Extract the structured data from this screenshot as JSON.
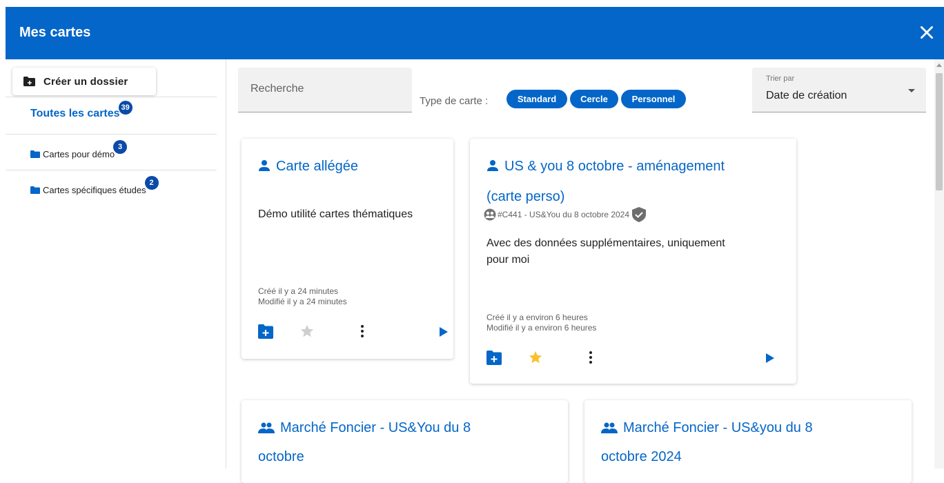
{
  "header": {
    "title": "Mes cartes",
    "close_icon": "close-icon"
  },
  "sidebar": {
    "create_button_label": "Créer un dossier",
    "all_cards": {
      "label": "Toutes les cartes",
      "count": "39"
    },
    "folders": [
      {
        "label": "Cartes pour démo",
        "count": "3"
      },
      {
        "label": "Cartes spécifiques études",
        "count": "2"
      }
    ]
  },
  "filters": {
    "search_placeholder": "Recherche",
    "type_label": "Type de carte :",
    "chips": [
      "Standard",
      "Cercle",
      "Personnel"
    ],
    "sort_caption": "Trier par",
    "sort_value": "Date de création"
  },
  "cards": [
    {
      "title": "Carte allégée",
      "icon": "person-icon",
      "description": "Démo utilité cartes thématiques",
      "created": "Créé il y a 24 minutes",
      "modified": "Modifié il y a 24 minutes",
      "starred": false
    },
    {
      "title_line1": "US & you 8 octobre - aménagement",
      "title_line2": "(carte perso)",
      "icon": "person-icon",
      "source": "#C441 - US&You du 8 octobre 2024",
      "description_line1": "Avec des données supplémentaires, uniquement",
      "description_line2": "pour moi",
      "created": "Créé il y a environ 6 heures",
      "modified": "Modifié il y a environ 6 heures",
      "starred": true
    },
    {
      "title_line1": "Marché Foncier - US&You du 8",
      "title_line2": "octobre",
      "icon": "group-icon"
    },
    {
      "title_line1": "Marché Foncier - US&you du 8",
      "title_line2": "octobre 2024",
      "icon": "group-icon"
    }
  ],
  "colors": {
    "primary": "#0466c8",
    "badge": "#0b4aa8",
    "star_on": "#fbc02d",
    "star_off": "#cfcfcf"
  }
}
